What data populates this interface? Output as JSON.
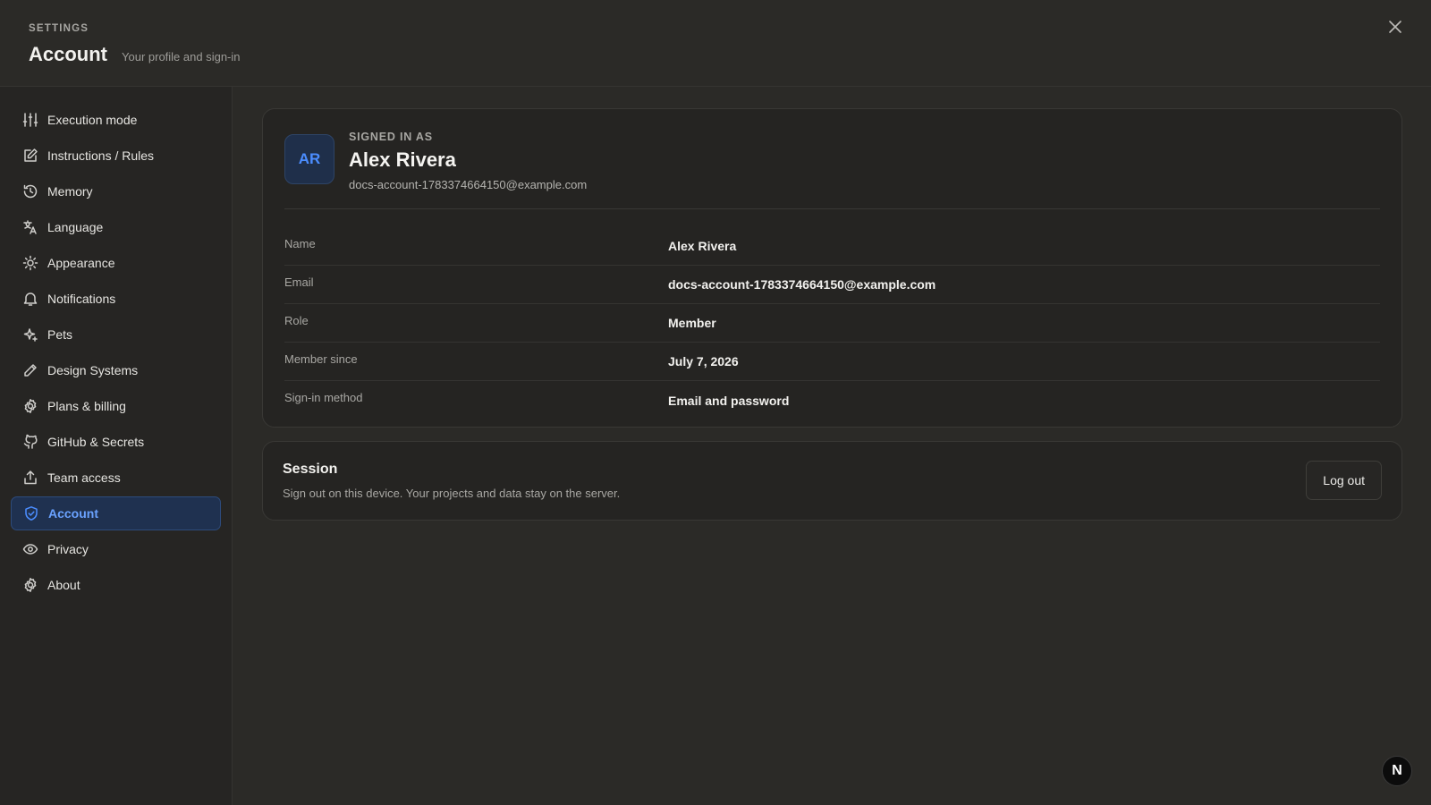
{
  "header": {
    "eyebrow": "SETTINGS",
    "title": "Account",
    "subtitle": "Your profile and sign-in"
  },
  "sidebar": {
    "items": [
      {
        "label": "Execution mode",
        "icon": "sliders-icon"
      },
      {
        "label": "Instructions / Rules",
        "icon": "edit-icon"
      },
      {
        "label": "Memory",
        "icon": "history-icon"
      },
      {
        "label": "Language",
        "icon": "translate-icon"
      },
      {
        "label": "Appearance",
        "icon": "sun-icon"
      },
      {
        "label": "Notifications",
        "icon": "bell-icon"
      },
      {
        "label": "Pets",
        "icon": "sparkle-icon"
      },
      {
        "label": "Design Systems",
        "icon": "pencil-icon"
      },
      {
        "label": "Plans & billing",
        "icon": "gear-icon"
      },
      {
        "label": "GitHub & Secrets",
        "icon": "github-icon"
      },
      {
        "label": "Team access",
        "icon": "share-icon"
      },
      {
        "label": "Account",
        "icon": "shield-check-icon",
        "active": true
      },
      {
        "label": "Privacy",
        "icon": "eye-icon"
      },
      {
        "label": "About",
        "icon": "gear-icon"
      }
    ]
  },
  "profile": {
    "initials": "AR",
    "signed_in_label": "SIGNED IN AS",
    "name": "Alex Rivera",
    "email": "docs-account-1783374664150@example.com",
    "rows": [
      {
        "label": "Name",
        "value": "Alex Rivera"
      },
      {
        "label": "Email",
        "value": "docs-account-1783374664150@example.com"
      },
      {
        "label": "Role",
        "value": "Member"
      },
      {
        "label": "Member since",
        "value": "July 7, 2026"
      },
      {
        "label": "Sign-in method",
        "value": "Email and password"
      }
    ]
  },
  "session": {
    "title": "Session",
    "description": "Sign out on this device. Your projects and data stay on the server.",
    "logout_label": "Log out"
  },
  "badge": {
    "letter": "N"
  },
  "colors": {
    "background": "#2b2a27",
    "sidebar": "#262523",
    "accent": "#4b8dff",
    "active_bg": "#1f3150"
  }
}
